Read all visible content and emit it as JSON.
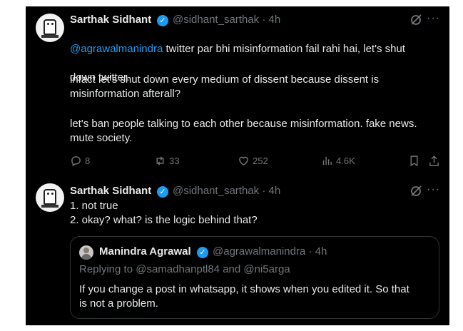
{
  "tweet1": {
    "name": "Sarthak Sidhant",
    "handle": "@sidhant_sarthak",
    "time": "· 4h",
    "mention": "@agrawalmanindra",
    "line1_rest": " twitter par bhi misinformation fail rahi hai, let's shut",
    "line2": "down twitter.",
    "para2": "infact let's shut down every medium of dissent because dissent is\nmisinformation afterall?",
    "para3": "let's ban people talking to each other because misinformation. fake news.\nmute society.",
    "actions": {
      "replies": "8",
      "retweets": "33",
      "likes": "252",
      "views": "4.6K"
    }
  },
  "tweet2": {
    "name": "Sarthak Sidhant",
    "handle": "@sidhant_sarthak",
    "time": "· 4h",
    "text": "1. not true\n2. okay? what? is the logic behind that?"
  },
  "quote": {
    "name": "Manindra Agrawal",
    "handle": "@agrawalmanindra",
    "time": "· 4h",
    "replying_prefix": "Replying to ",
    "replying_to1": "@samadhanptl84",
    "replying_and": " and ",
    "replying_to2": "@ni5arga",
    "text": "If you change a post in whatsapp, it shows when you edited it. So that\nis not a problem."
  },
  "colors": {
    "background": "#000000",
    "text": "#e7e9ea",
    "muted": "#71767b",
    "link": "#1d9bf0"
  },
  "icons": [
    "verified-badge-icon",
    "grok-slash-icon",
    "more-icon",
    "reply-icon",
    "retweet-icon",
    "like-icon",
    "views-icon",
    "bookmark-icon",
    "share-icon"
  ]
}
